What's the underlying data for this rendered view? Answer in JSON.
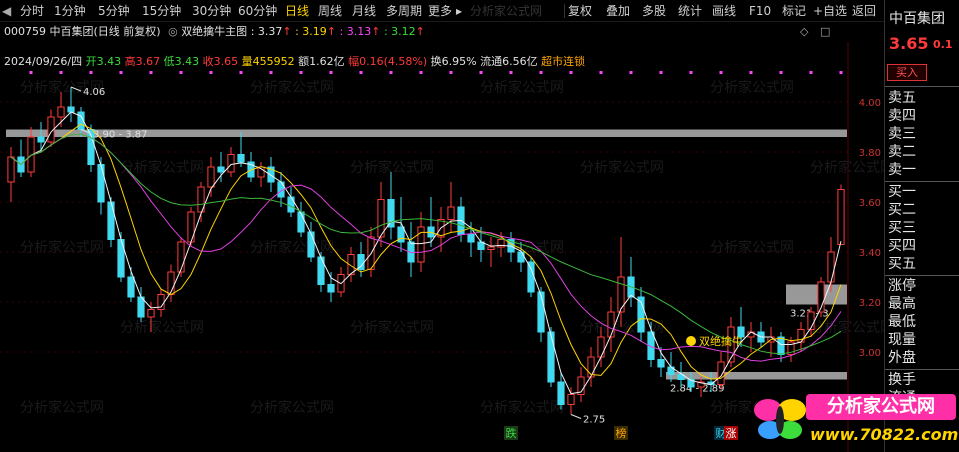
{
  "toolbar": {
    "periods": [
      "分时",
      "1分钟",
      "5分钟",
      "15分钟",
      "30分钟",
      "60分钟",
      "日线",
      "周线",
      "月线",
      "多周期",
      "更多"
    ],
    "active_period": "日线",
    "more_arrow": "▸",
    "watermark": "分析家公式网",
    "right_buttons": [
      "复权",
      "叠加",
      "多股",
      "统计",
      "画线",
      "F10",
      "标记",
      "+自选",
      "返回"
    ]
  },
  "header": {
    "code_name": "000759 中百集团(日线 前复权)",
    "indicator_name": "双绝擒牛主图",
    "indicator_values": [
      {
        "label": ": 3.37",
        "color": "#e0e0e0",
        "arrow": "↑"
      },
      {
        "label": ": 3.19",
        "color": "#ffd400",
        "arrow": "↑"
      },
      {
        "label": ": 3.13",
        "color": "#ff44ff",
        "arrow": "↑"
      },
      {
        "label": ": 3.12",
        "color": "#3cdc3c",
        "arrow": "↑"
      }
    ],
    "date": "2024/09/26/四",
    "open_label": "开",
    "open": "3.43",
    "high_label": "高",
    "high": "3.67",
    "low_label": "低",
    "low": "3.43",
    "close_label": "收",
    "close": "3.65",
    "vol_label": "量",
    "vol": "455952",
    "amount_label": "额",
    "amount": "1.62亿",
    "range_label": "幅",
    "range": "0.16(4.58%)",
    "turnover_label": "换",
    "turnover": "6.95%",
    "float_label": "流通",
    "float": "6.56亿",
    "concept": "超市连锁"
  },
  "colors": {
    "up": "#ff3a3a",
    "down": "#41d9f0",
    "ma_white": "#f2f2f2",
    "ma_yellow": "#ffd400",
    "ma_magenta": "#e040e0",
    "ma_green": "#3cb83c",
    "gray_band": "#b3b3b3",
    "grid": "#3a0000"
  },
  "chart_data": {
    "type": "candlestick",
    "ylim": [
      2.66,
      4.16
    ],
    "y_ticks": [
      "4.00",
      "3.80",
      "3.60",
      "3.40",
      "3.20",
      "3.00"
    ],
    "candles": [
      [
        3.68,
        3.82,
        3.6,
        3.78
      ],
      [
        3.78,
        3.85,
        3.7,
        3.72
      ],
      [
        3.72,
        3.9,
        3.7,
        3.86
      ],
      [
        3.86,
        3.92,
        3.8,
        3.84
      ],
      [
        3.84,
        3.97,
        3.82,
        3.94
      ],
      [
        3.94,
        4.04,
        3.9,
        3.98
      ],
      [
        3.98,
        4.06,
        3.92,
        3.96
      ],
      [
        3.96,
        3.98,
        3.86,
        3.89
      ],
      [
        3.89,
        3.91,
        3.72,
        3.75
      ],
      [
        3.75,
        3.78,
        3.55,
        3.6
      ],
      [
        3.6,
        3.62,
        3.42,
        3.45
      ],
      [
        3.45,
        3.48,
        3.28,
        3.3
      ],
      [
        3.3,
        3.34,
        3.2,
        3.22
      ],
      [
        3.22,
        3.26,
        3.12,
        3.14
      ],
      [
        3.14,
        3.2,
        3.08,
        3.17
      ],
      [
        3.17,
        3.25,
        3.14,
        3.23
      ],
      [
        3.23,
        3.35,
        3.2,
        3.32
      ],
      [
        3.32,
        3.46,
        3.3,
        3.44
      ],
      [
        3.44,
        3.58,
        3.42,
        3.56
      ],
      [
        3.56,
        3.68,
        3.52,
        3.66
      ],
      [
        3.66,
        3.78,
        3.62,
        3.74
      ],
      [
        3.74,
        3.8,
        3.68,
        3.72
      ],
      [
        3.72,
        3.82,
        3.7,
        3.79
      ],
      [
        3.79,
        3.88,
        3.74,
        3.76
      ],
      [
        3.76,
        3.8,
        3.68,
        3.7
      ],
      [
        3.7,
        3.76,
        3.66,
        3.74
      ],
      [
        3.74,
        3.78,
        3.64,
        3.68
      ],
      [
        3.68,
        3.72,
        3.58,
        3.62
      ],
      [
        3.62,
        3.66,
        3.54,
        3.56
      ],
      [
        3.56,
        3.6,
        3.46,
        3.48
      ],
      [
        3.48,
        3.52,
        3.36,
        3.38
      ],
      [
        3.38,
        3.4,
        3.24,
        3.27
      ],
      [
        3.27,
        3.32,
        3.2,
        3.24
      ],
      [
        3.24,
        3.34,
        3.22,
        3.31
      ],
      [
        3.31,
        3.42,
        3.28,
        3.39
      ],
      [
        3.39,
        3.44,
        3.3,
        3.33
      ],
      [
        3.33,
        3.5,
        3.3,
        3.46
      ],
      [
        3.46,
        3.68,
        3.42,
        3.61
      ],
      [
        3.61,
        3.72,
        3.45,
        3.5
      ],
      [
        3.5,
        3.62,
        3.4,
        3.44
      ],
      [
        3.44,
        3.52,
        3.3,
        3.36
      ],
      [
        3.36,
        3.56,
        3.32,
        3.5
      ],
      [
        3.5,
        3.62,
        3.42,
        3.46
      ],
      [
        3.46,
        3.58,
        3.4,
        3.53
      ],
      [
        3.53,
        3.68,
        3.48,
        3.58
      ],
      [
        3.58,
        3.62,
        3.44,
        3.47
      ],
      [
        3.47,
        3.52,
        3.38,
        3.44
      ],
      [
        3.44,
        3.5,
        3.36,
        3.41
      ],
      [
        3.41,
        3.46,
        3.34,
        3.42
      ],
      [
        3.42,
        3.48,
        3.38,
        3.45
      ],
      [
        3.45,
        3.48,
        3.36,
        3.4
      ],
      [
        3.4,
        3.44,
        3.32,
        3.36
      ],
      [
        3.36,
        3.38,
        3.22,
        3.24
      ],
      [
        3.24,
        3.26,
        3.04,
        3.08
      ],
      [
        3.08,
        3.1,
        2.86,
        2.88
      ],
      [
        2.88,
        2.92,
        2.77,
        2.79
      ],
      [
        2.79,
        2.86,
        2.75,
        2.83
      ],
      [
        2.83,
        2.94,
        2.8,
        2.9
      ],
      [
        2.9,
        3.02,
        2.86,
        2.98
      ],
      [
        2.98,
        3.1,
        2.94,
        3.06
      ],
      [
        3.06,
        3.22,
        3.0,
        3.16
      ],
      [
        3.16,
        3.46,
        3.1,
        3.3
      ],
      [
        3.3,
        3.38,
        3.18,
        3.22
      ],
      [
        3.22,
        3.26,
        3.04,
        3.08
      ],
      [
        3.08,
        3.12,
        2.94,
        2.97
      ],
      [
        2.97,
        3.02,
        2.9,
        2.94
      ],
      [
        2.94,
        3.0,
        2.88,
        2.91
      ],
      [
        2.91,
        2.96,
        2.86,
        2.89
      ],
      [
        2.89,
        2.92,
        2.84,
        2.86
      ],
      [
        2.86,
        2.9,
        2.82,
        2.88
      ],
      [
        2.88,
        2.92,
        2.84,
        2.87
      ],
      [
        2.87,
        3.0,
        2.85,
        2.96
      ],
      [
        2.96,
        3.14,
        2.94,
        3.1
      ],
      [
        3.1,
        3.18,
        3.02,
        3.06
      ],
      [
        3.06,
        3.12,
        3.0,
        3.08
      ],
      [
        3.08,
        3.12,
        3.02,
        3.04
      ],
      [
        3.04,
        3.1,
        2.98,
        3.06
      ],
      [
        3.06,
        3.08,
        2.96,
        2.99
      ],
      [
        2.99,
        3.06,
        2.96,
        3.04
      ],
      [
        3.04,
        3.12,
        3.0,
        3.09
      ],
      [
        3.09,
        3.18,
        3.06,
        3.16
      ],
      [
        3.16,
        3.3,
        3.14,
        3.28
      ],
      [
        3.28,
        3.46,
        3.24,
        3.4
      ],
      [
        3.43,
        3.67,
        3.43,
        3.65
      ]
    ],
    "gray_bands": [
      {
        "y_low": 3.86,
        "y_high": 3.89,
        "label": "",
        "from_index": 0
      },
      {
        "y_low": 3.19,
        "y_high": 3.27,
        "label": "3.21 - 3",
        "from_index": 78
      },
      {
        "y_low": 2.89,
        "y_high": 2.92,
        "label": "2.84 - 2.89",
        "from_index": 66
      }
    ],
    "annotations": [
      {
        "text": "4.06",
        "index": 6,
        "value": 4.06,
        "color": "#e0e0e0"
      },
      {
        "text": "3.90 - 3.87",
        "index": 7,
        "value": 3.89,
        "color": "#e0e0e0"
      },
      {
        "text": "2.75",
        "index": 56,
        "value": 2.75,
        "color": "#e0e0e0"
      },
      {
        "text": "双绝擒牛",
        "index": 69,
        "value": 3.02,
        "color": "#ffd400"
      }
    ],
    "bottom_labels": [
      {
        "text": "跌",
        "index": 50,
        "color": "#3cdc3c",
        "bg": "#1a3a1a"
      },
      {
        "text": "榜",
        "index": 61,
        "color": "#ffa500",
        "bg": "#3a2a00"
      },
      {
        "text": "财",
        "index": 71,
        "color": "#41d9f0",
        "bg": "#002a3a"
      },
      {
        "text": "涨",
        "index": 72,
        "color": "#ffffff",
        "bg": "#aa0000"
      }
    ]
  },
  "right_panel": {
    "stock_name": "中百集团",
    "price": "3.65",
    "change": "0.1",
    "buy_button": "买入",
    "sell_rows": [
      "卖五",
      "卖四",
      "卖三",
      "卖二",
      "卖一"
    ],
    "buy_rows": [
      "买一",
      "买二",
      "买三",
      "买四",
      "买五"
    ],
    "stats": [
      "涨停",
      "最高",
      "最低",
      "现量",
      "外盘"
    ],
    "extra": [
      "换手",
      "流通"
    ]
  },
  "logo": {
    "text": "分析家公式网",
    "url_text": "www.70822.com"
  }
}
